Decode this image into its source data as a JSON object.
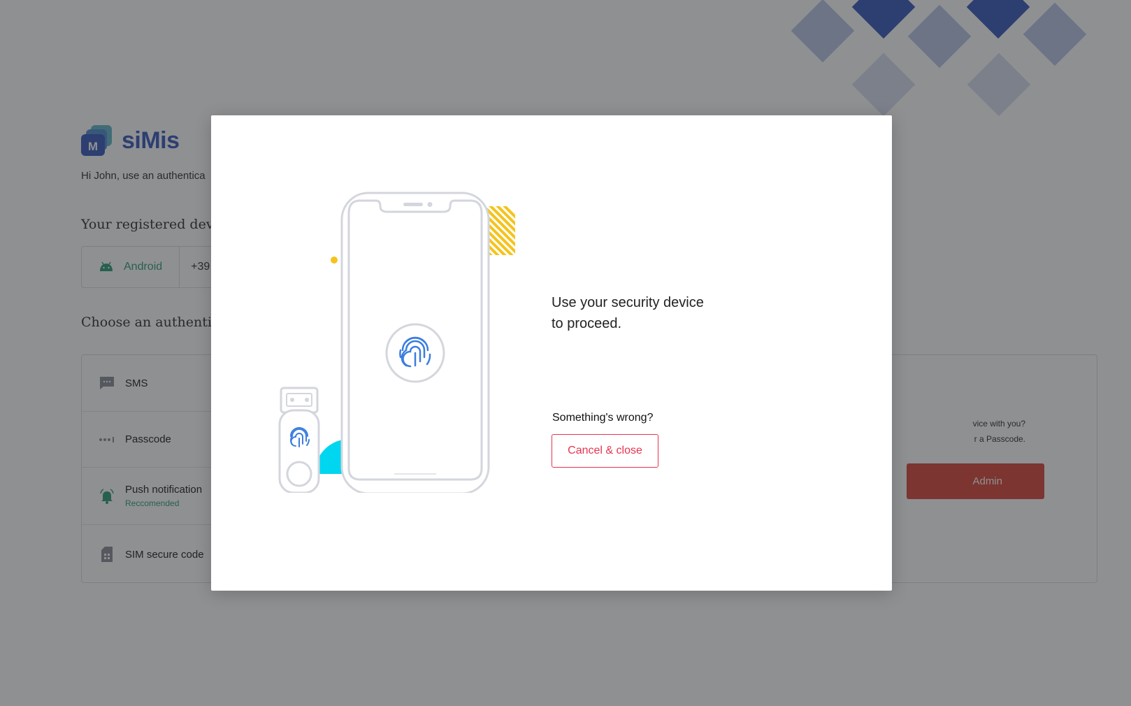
{
  "app": {
    "brand": "siMis",
    "logo_letter": "M"
  },
  "background": {
    "greeting": "Hi John, use an authentica",
    "registered_title": "Your registered devi",
    "device": {
      "os": "Android",
      "number": "+39"
    },
    "choose_title": "Choose an authentic",
    "methods": [
      {
        "label": "SMS",
        "icon": "chat-bubble-icon"
      },
      {
        "label": "Passcode",
        "icon": "passcode-dots-icon"
      },
      {
        "label": "Push notification",
        "sublabel": "Reccomended",
        "icon": "bell-icon"
      },
      {
        "label": "SIM secure code",
        "icon": "sim-card-icon"
      }
    ],
    "right_panel": {
      "line1": "vice with you?",
      "line2": "r a Passcode.",
      "button": "Admin"
    }
  },
  "modal": {
    "prompt_line1": "Use your security device",
    "prompt_line2": "to proceed.",
    "wrong_text": "Something's wrong?",
    "cancel_label": "Cancel & close"
  },
  "colors": {
    "brand": "#3b5bbd",
    "accent_green": "#2f9e78",
    "danger": "#e8334f",
    "admin_button": "#d9483b",
    "fingerprint_blue": "#3b7de0",
    "stripe_yellow": "#f5c31c",
    "cyan": "#00d6f0"
  }
}
